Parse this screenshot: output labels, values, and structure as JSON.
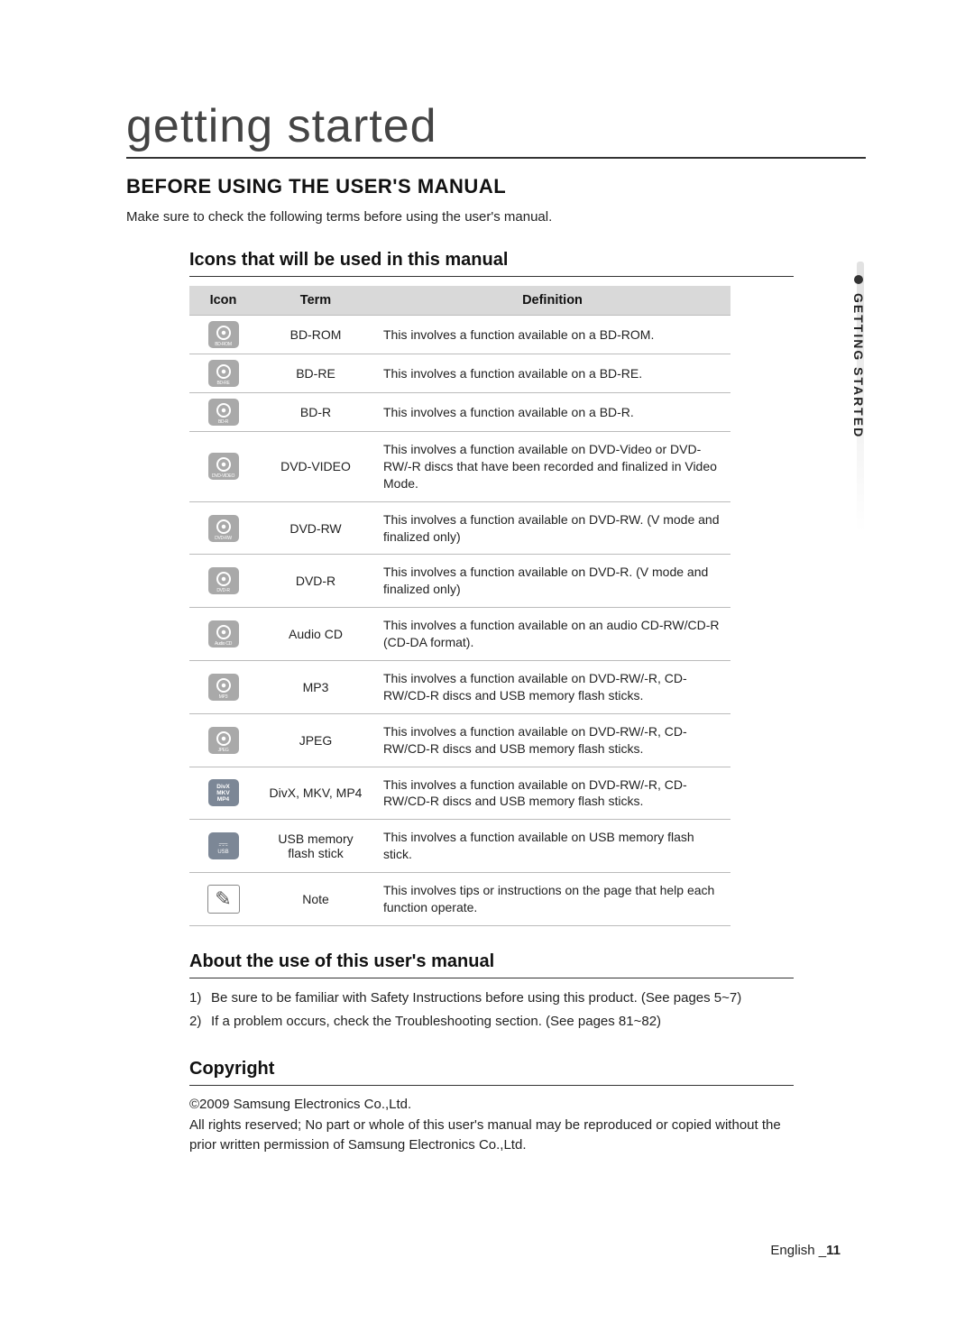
{
  "section_title": "getting started",
  "heading": "BEFORE USING THE USER'S MANUAL",
  "intro": "Make sure to check the following terms before using the user's manual.",
  "icons_subhead": "Icons that will be used in this manual",
  "table": {
    "headers": {
      "icon": "Icon",
      "term": "Term",
      "definition": "Definition"
    },
    "rows": [
      {
        "icon_label": "BD-ROM",
        "icon_type": "disc",
        "term": "BD-ROM",
        "definition": "This involves a function available on a BD-ROM."
      },
      {
        "icon_label": "BD-RE",
        "icon_type": "disc",
        "term": "BD-RE",
        "definition": "This involves a function available on a BD-RE."
      },
      {
        "icon_label": "BD-R",
        "icon_type": "disc",
        "term": "BD-R",
        "definition": "This involves a function available on a BD-R."
      },
      {
        "icon_label": "DVD-VIDEO",
        "icon_type": "disc",
        "term": "DVD-VIDEO",
        "definition": "This involves a function available on DVD-Video or DVD-RW/-R discs that have been recorded and finalized in Video Mode."
      },
      {
        "icon_label": "DVD-RW",
        "icon_type": "disc",
        "term": "DVD-RW",
        "definition": "This involves a function available on DVD-RW. (V mode and finalized only)"
      },
      {
        "icon_label": "DVD-R",
        "icon_type": "disc",
        "term": "DVD-R",
        "definition": "This involves a function available on DVD-R. (V mode and finalized only)"
      },
      {
        "icon_label": "Audio CD",
        "icon_type": "disc",
        "term": "Audio CD",
        "definition": "This involves a function available on an audio CD-RW/CD-R (CD-DA format)."
      },
      {
        "icon_label": "MP3",
        "icon_type": "disc",
        "term": "MP3",
        "definition": "This involves a function available on DVD-RW/-R, CD-RW/CD-R discs and USB memory flash sticks."
      },
      {
        "icon_label": "JPEG",
        "icon_type": "disc",
        "term": "JPEG",
        "definition": "This involves a function available on DVD-RW/-R, CD-RW/CD-R discs and USB memory flash sticks."
      },
      {
        "icon_label": "DivX\nMKV\nMP4",
        "icon_type": "text",
        "term": "DivX, MKV, MP4",
        "definition": "This involves a function available on DVD-RW/-R, CD-RW/CD-R discs and USB memory flash sticks."
      },
      {
        "icon_label": "USB",
        "icon_type": "usb",
        "term": "USB memory flash stick",
        "definition": "This involves a function available on USB memory flash stick."
      },
      {
        "icon_label": "✎",
        "icon_type": "note",
        "term": "Note",
        "definition": "This involves tips or instructions on the page that help each function operate."
      }
    ]
  },
  "about_subhead": "About the use of this user's manual",
  "about_list": [
    "Be sure to be familiar with Safety Instructions before using this product. (See pages 5~7)",
    "If a problem occurs, check the Troubleshooting section. (See pages 81~82)"
  ],
  "copyright_subhead": "Copyright",
  "copyright_lines": [
    "©2009 Samsung Electronics Co.,Ltd.",
    "All rights reserved; No part or whole of this user's manual may be reproduced or copied without the prior written permission of Samsung Electronics Co.,Ltd."
  ],
  "side_tab": "GETTING STARTED",
  "footer": {
    "lang": "English",
    "sep": "_",
    "page": "11"
  }
}
